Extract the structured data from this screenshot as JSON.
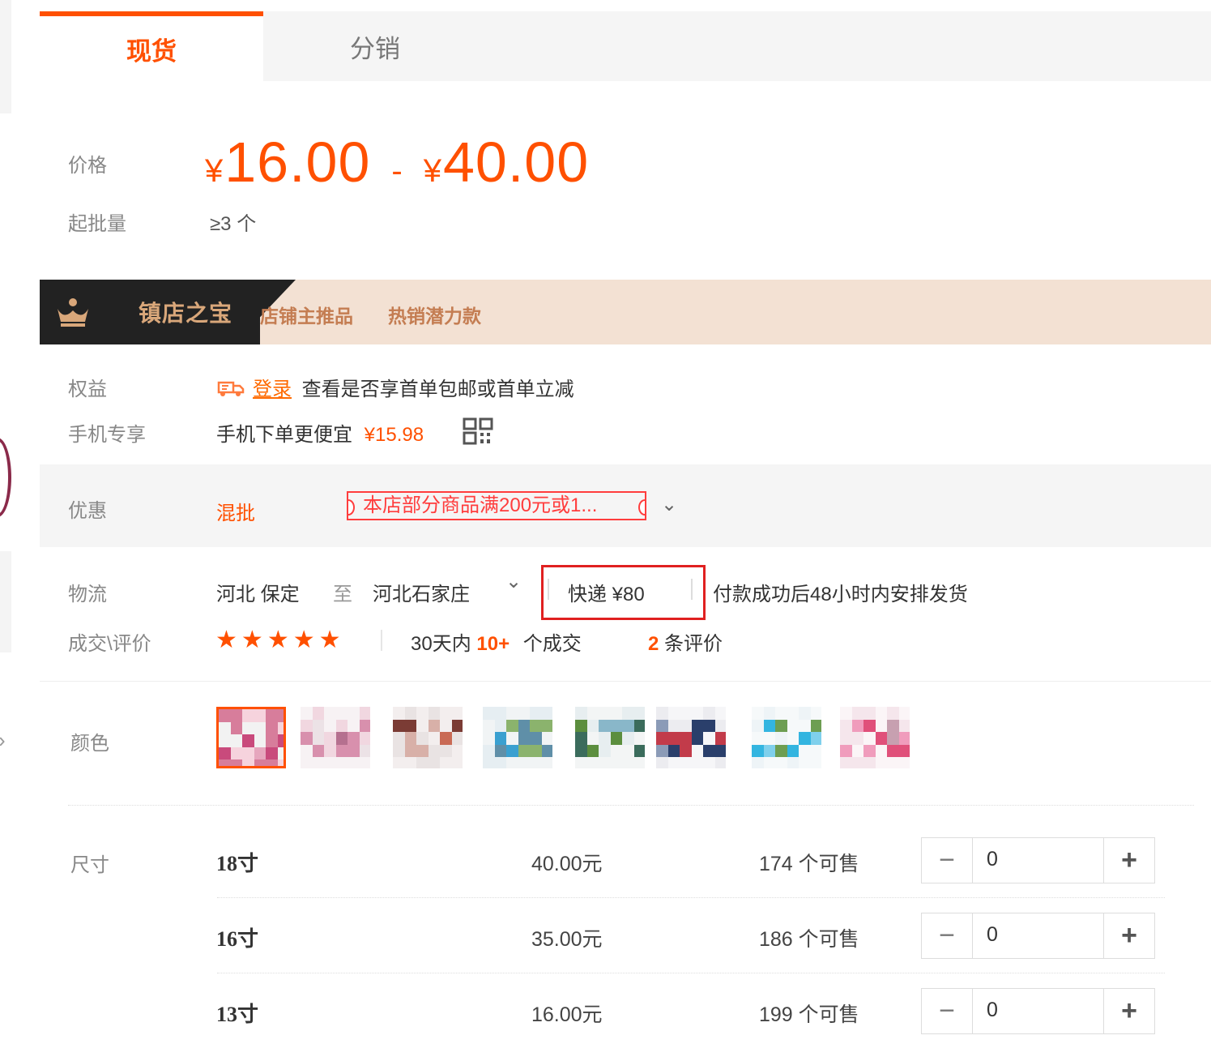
{
  "tabs": [
    {
      "label": "现货",
      "active": true
    },
    {
      "label": "分销",
      "active": false
    }
  ],
  "price": {
    "label": "价格",
    "currency": "¥",
    "min": "16.00",
    "separator": "-",
    "max": "40.00"
  },
  "min_order": {
    "label": "起批量",
    "value": "≥3 个"
  },
  "banner": {
    "title": "镇店之宝",
    "tags": [
      "店铺主推品",
      "热销潜力款"
    ]
  },
  "benefit": {
    "label": "权益",
    "login_link": "登录",
    "text": "查看是否享首单包邮或首单立减"
  },
  "mobile": {
    "label": "手机专享",
    "text": "手机下单更便宜",
    "price": "¥15.98"
  },
  "promo": {
    "label": "优惠",
    "type": "混批",
    "coupon_text": "本店部分商品满200元或1..."
  },
  "logistics": {
    "label": "物流",
    "origin": "河北 保定",
    "to": "至",
    "destination": "河北石家庄",
    "express": "快递 ¥80",
    "shipping_note": "付款成功后48小时内安排发货"
  },
  "deals": {
    "label": "成交\\评价",
    "rating_stars": 5,
    "period": "30天内",
    "count": "10+",
    "count_unit": "个成交",
    "reviews": "2",
    "reviews_unit": "条评价"
  },
  "color": {
    "label": "颜色",
    "selected_index": 0,
    "swatch_count": 8
  },
  "size": {
    "label": "尺寸",
    "rows": [
      {
        "name": "18寸",
        "price": "40.00元",
        "stock": "174 个可售",
        "qty": "0"
      },
      {
        "name": "16寸",
        "price": "35.00元",
        "stock": "186 个可售",
        "qty": "0"
      },
      {
        "name": "13寸",
        "price": "16.00元",
        "stock": "199 个可售",
        "qty": "0"
      }
    ]
  },
  "colors": {
    "accent": "#ff5000",
    "banner_dark": "#222222",
    "banner_light": "#f3e1d3",
    "highlight_box": "#e02020"
  }
}
